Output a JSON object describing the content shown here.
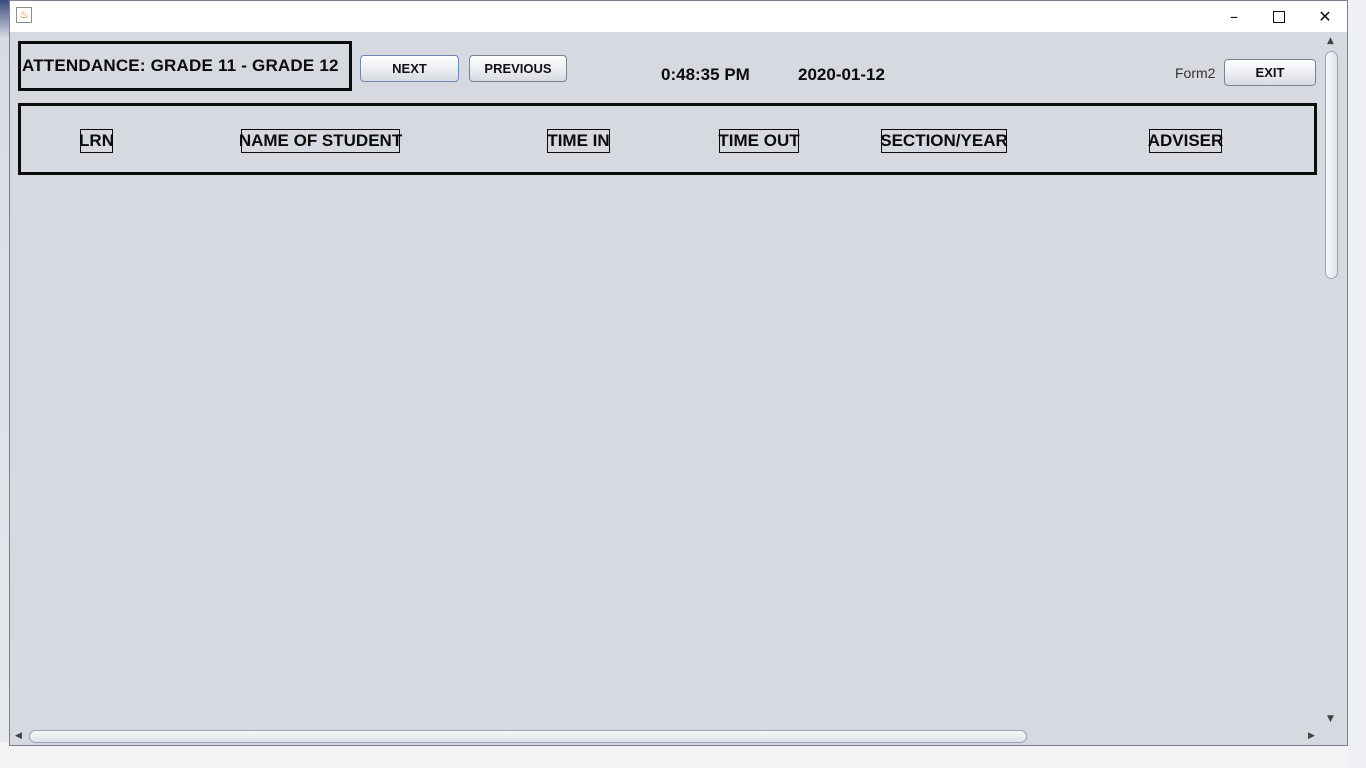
{
  "window": {
    "app_icon": "java-cup-icon",
    "controls": {
      "minimize": "–",
      "close": "✕"
    }
  },
  "header": {
    "title": "ATTENDANCE: GRADE 11 - GRADE 12",
    "next_label": "NEXT",
    "previous_label": "PREVIOUS",
    "time": "0:48:35 PM",
    "date": "2020-01-12",
    "form_label": "Form2",
    "exit_label": "EXIT"
  },
  "table": {
    "columns": [
      "LRN",
      "NAME OF STUDENT",
      "TIME IN",
      "TIME OUT",
      "SECTION/YEAR",
      "ADVISER"
    ]
  },
  "colors": {
    "panel": "#d6d9e0",
    "border": "#0b0b0b"
  }
}
